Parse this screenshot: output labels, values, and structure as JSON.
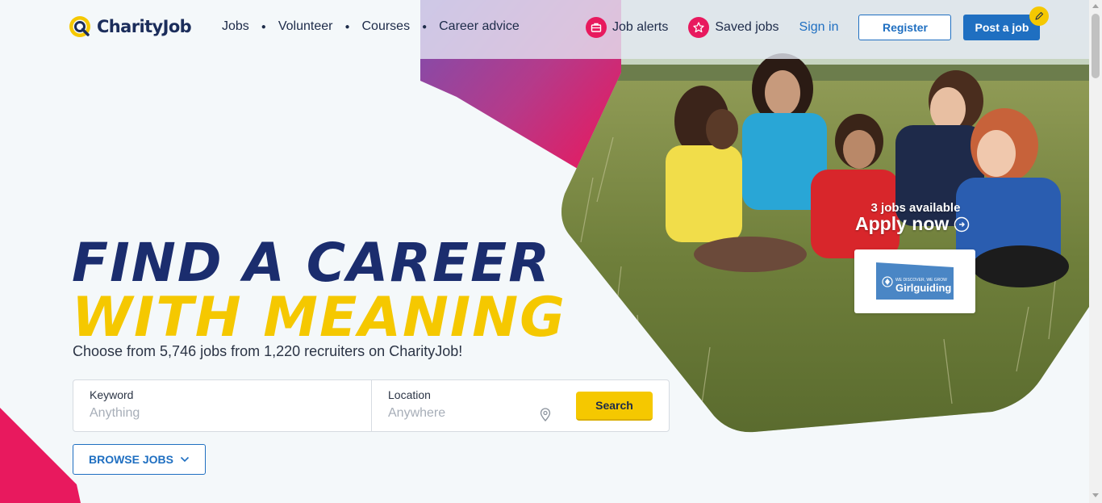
{
  "header": {
    "logo_text": "CharityJob",
    "nav": [
      {
        "label": "Jobs"
      },
      {
        "label": "Volunteer"
      },
      {
        "label": "Courses"
      },
      {
        "label": "Career advice"
      }
    ],
    "job_alerts_label": "Job alerts",
    "saved_jobs_label": "Saved jobs",
    "sign_in_label": "Sign in",
    "register_label": "Register",
    "post_job_label": "Post a job"
  },
  "hero": {
    "headline_line1": "FIND A CAREER",
    "headline_line2": "WITH MEANING",
    "subline": "Choose from 5,746 jobs from 1,220 recruiters on CharityJob!",
    "featured": {
      "jobs_available": "3 jobs available",
      "apply_label": "Apply now",
      "recruiter_tagline": "WE DISCOVER, WE GROW",
      "recruiter_name": "Girlguiding"
    }
  },
  "search": {
    "keyword_label": "Keyword",
    "keyword_placeholder": "Anything",
    "keyword_value": "",
    "location_label": "Location",
    "location_placeholder": "Anywhere",
    "location_value": "",
    "search_label": "Search"
  },
  "browse_label": "BROWSE JOBS",
  "icons": {
    "job_alerts": "briefcase-icon",
    "saved_jobs": "star-icon",
    "post_job_badge": "pencil-icon",
    "location": "map-pin-icon",
    "browse": "chevron-down-icon",
    "apply": "arrow-circle-icon"
  },
  "colors": {
    "brand_blue": "#1f6fc1",
    "navy": "#1b2d6e",
    "yellow": "#f5c800",
    "pink": "#e8195e",
    "purple": "#6e4aa8"
  }
}
